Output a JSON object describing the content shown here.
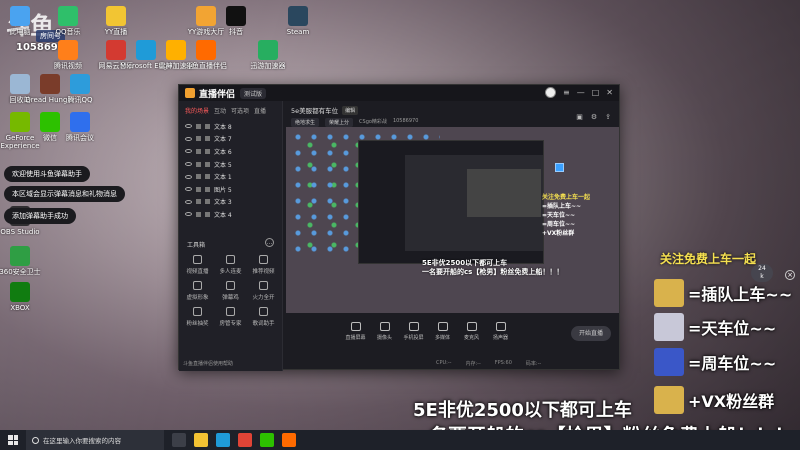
{
  "watermark": {
    "logo": "斗鱼",
    "room_label": "房间号",
    "room_id": "10586970"
  },
  "desktop_icons": [
    {
      "label": "此电脑",
      "color": "#4aa3f0"
    },
    {
      "label": "QQ音乐",
      "color": "#2fbf6a"
    },
    {
      "label": "YY直播",
      "color": "#f2c533"
    },
    {
      "label": "YY游戏大厅",
      "color": "#f2a433"
    },
    {
      "label": "抖音",
      "color": "#111111"
    },
    {
      "label": "Steam",
      "color": "#2a475e"
    },
    {
      "label": "腾讯视频",
      "color": "#ff7f1a"
    },
    {
      "label": "网易云音乐",
      "color": "#d33a31"
    },
    {
      "label": "Microsoft Edge",
      "color": "#1f9bd8"
    },
    {
      "label": "雷神加速器",
      "color": "#ffb000"
    },
    {
      "label": "斗鱼直播伴侣",
      "color": "#ff6a00"
    },
    {
      "label": "迅游加速器",
      "color": "#27ae60"
    },
    {
      "label": "回收站",
      "color": "#9bb7d4"
    },
    {
      "label": "Dread Hunger",
      "color": "#7a3c2a"
    },
    {
      "label": "腾讯QQ",
      "color": "#2d9cdb"
    },
    {
      "label": "GeForce Experience",
      "color": "#76b900"
    },
    {
      "label": "微信",
      "color": "#2dc100"
    },
    {
      "label": "腾讯会议",
      "color": "#2f6fed"
    },
    {
      "label": "OBS Studio",
      "color": "#302e31"
    },
    {
      "label": "360安全卫士",
      "color": "#2f9e44"
    },
    {
      "label": "XBOX",
      "color": "#107c10"
    }
  ],
  "toasts": [
    "欢迎使用斗鱼弹幕助手",
    "本区域会显示弹幕消息和礼物消息",
    "添加弹幕助手成功"
  ],
  "app": {
    "title": "直播伴侣",
    "version": "测试版",
    "tabs": [
      "我的场景",
      "互动",
      "可选项",
      "直播"
    ],
    "sources": [
      {
        "name": "文本 8"
      },
      {
        "name": "文本 7"
      },
      {
        "name": "文本 6"
      },
      {
        "name": "文本 5"
      },
      {
        "name": "文本 1"
      },
      {
        "name": "图片 5"
      },
      {
        "name": "文本 3"
      },
      {
        "name": "文本 4"
      }
    ],
    "tools_title": "工具箱",
    "tools": [
      {
        "label": "视频直播",
        "icon": "video-icon"
      },
      {
        "label": "多人连麦",
        "icon": "mic-icon"
      },
      {
        "label": "推荐视频",
        "icon": "play-icon"
      },
      {
        "label": "虚拟形象",
        "icon": "avatar-icon"
      },
      {
        "label": "弹幕鸡",
        "icon": "danmu-icon"
      },
      {
        "label": "火力全开",
        "icon": "fire-icon"
      },
      {
        "label": "粉丝抽奖",
        "icon": "gift-icon"
      },
      {
        "label": "房管专家",
        "icon": "shield-icon"
      },
      {
        "label": "歌词助手",
        "icon": "music-icon"
      }
    ],
    "bottom_note": "斗鱼直播伴侣使用帮助",
    "room_name": "5e美服都有车位",
    "edit_label": "编辑",
    "meta": {
      "category": "绝地求生",
      "tag": "荣耀上分",
      "site": "CSgo精彩战",
      "id": "10586970"
    },
    "toolbar": [
      {
        "label": "直播屏幕",
        "icon": "monitor-icon"
      },
      {
        "label": "摄像头",
        "icon": "camera-icon"
      },
      {
        "label": "手机投屏",
        "icon": "phone-icon"
      },
      {
        "label": "多媒体",
        "icon": "media-icon"
      },
      {
        "label": "麦克风",
        "icon": "microphone-icon"
      },
      {
        "label": "扬声器",
        "icon": "speaker-icon"
      }
    ],
    "start_live": "开始直播",
    "status": [
      "CPU:--",
      "内存:--",
      "FPS:60",
      "码率:--"
    ],
    "preview_overlay": [
      "关注免费上车一起",
      "=插队上车~~",
      "=天车位~~",
      "=周车位~~",
      "+VX粉丝群"
    ],
    "preview_banner": [
      "5E非优2500以下都可上车",
      "一名要开船的cs【枪男】粉丝免费上船！！！"
    ]
  },
  "overlay": {
    "follow_title": "关注免费上车一起",
    "perks": [
      {
        "text": "=插队上车~~",
        "color": "#d9b24c"
      },
      {
        "text": "=天车位~~",
        "color": "#c8c8d8"
      },
      {
        "text": "=周车位~~",
        "color": "#3a57c8"
      },
      {
        "text": "+VX粉丝群",
        "color": "#d9b24c"
      }
    ],
    "counter": {
      "value": "24",
      "unit": "k"
    },
    "banner_line1": "5E非优2500以下都可上车",
    "banner_line2": "一名要开船的cs【枪男】粉丝免费上船！！！"
  },
  "taskbar": {
    "search_placeholder": "在这里输入你要搜索的内容",
    "apps": [
      {
        "name": "task-view",
        "color": "#3c3f48"
      },
      {
        "name": "file-explorer",
        "color": "#f2c233"
      },
      {
        "name": "edge",
        "color": "#1f9bd8"
      },
      {
        "name": "chrome",
        "color": "#e04436"
      },
      {
        "name": "wechat",
        "color": "#2dc100"
      },
      {
        "name": "douyu-companion",
        "color": "#ff6a00"
      }
    ]
  }
}
